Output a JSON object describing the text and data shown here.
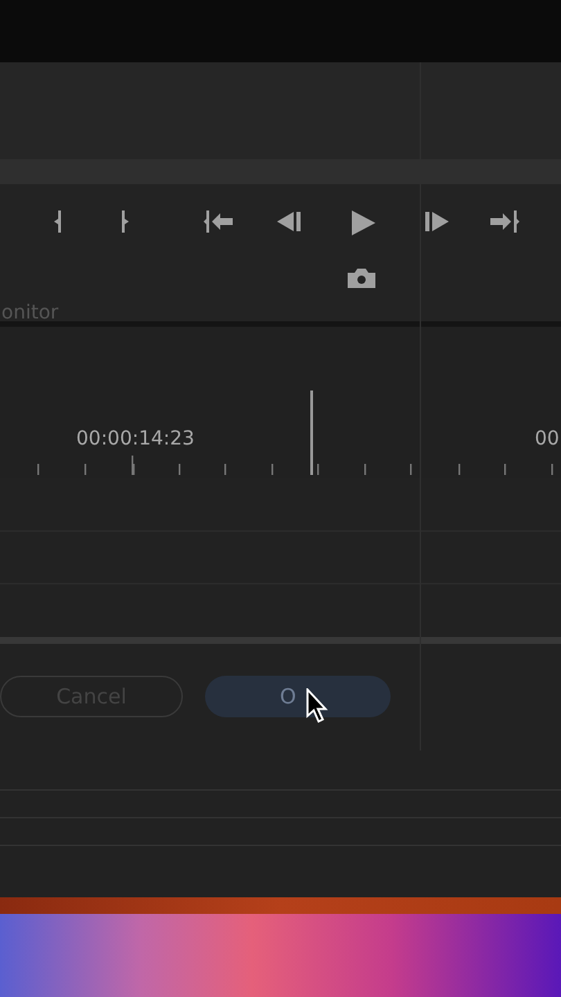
{
  "monitor_label": "onitor",
  "timeline": {
    "timecodes": [
      "00:00:14:23",
      "00"
    ]
  },
  "dialog": {
    "buttons": [
      {
        "label": "Cancel",
        "kind": "secondary"
      },
      {
        "label": "O",
        "kind": "primary"
      }
    ]
  }
}
